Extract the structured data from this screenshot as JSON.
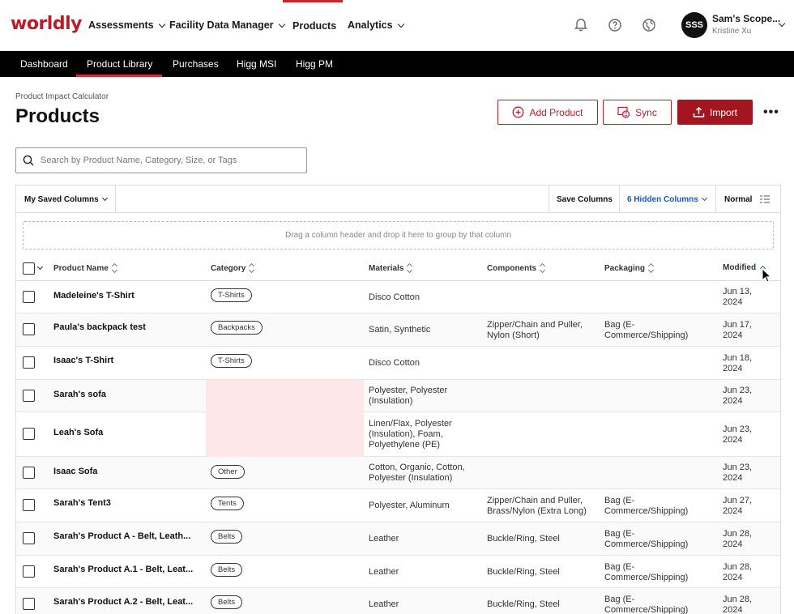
{
  "nav": {
    "logo": "worldly",
    "items": [
      {
        "label": "Assessments",
        "has_dropdown": true
      },
      {
        "label": "Facility Data Manager",
        "has_dropdown": true
      },
      {
        "label": "Products",
        "has_dropdown": false,
        "active": true
      },
      {
        "label": "Analytics",
        "has_dropdown": true
      }
    ],
    "icons": [
      "bell-icon",
      "help-icon",
      "globe-icon"
    ],
    "user": {
      "initials": "SSS",
      "name": "Sam's Scope...",
      "sub": "Kristine Xu"
    }
  },
  "subnav": {
    "items": [
      "Dashboard",
      "Product Library",
      "Purchases",
      "Higg MSI",
      "Higg PM"
    ],
    "active": "Product Library"
  },
  "page": {
    "breadcrumb": "Product Impact Calculator",
    "title": "Products",
    "buttons": {
      "add": "Add Product",
      "sync": "Sync",
      "import": "Import"
    }
  },
  "search": {
    "placeholder": "Search by Product Name, Category, Size, or Tags"
  },
  "toolbar": {
    "saved_columns": "My Saved Columns",
    "save_columns": "Save Columns",
    "hidden_columns": "6 Hidden Columns",
    "density": "Normal"
  },
  "dropzone": "Drag a column header and drop it here to group by that column",
  "columns": {
    "name": "Product Name",
    "category": "Category",
    "materials": "Materials",
    "components": "Components",
    "packaging": "Packaging",
    "modified": "Modified"
  },
  "rows": [
    {
      "name": "Madeleine's T-Shirt",
      "category": "T-Shirts",
      "materials": "Disco Cotton",
      "components": "",
      "packaging": "",
      "modified": "Jun 13, 2024"
    },
    {
      "name": "Paula's backpack test",
      "category": "Backpacks",
      "materials": "Satin, Synthetic",
      "components": "Zipper/Chain and Puller, Nylon (Short)",
      "packaging": "Bag (E-Commerce/Shipping)",
      "modified": "Jun 17, 2024"
    },
    {
      "name": "Isaac's T-Shirt",
      "category": "T-Shirts",
      "materials": "Disco Cotton",
      "components": "",
      "packaging": "",
      "modified": "Jun 18, 2024"
    },
    {
      "name": "Sarah's sofa",
      "category": "",
      "materials": "Polyester, Polyester (Insulation)",
      "components": "",
      "packaging": "",
      "modified": "Jun 23, 2024"
    },
    {
      "name": "Leah's Sofa",
      "category": "",
      "materials": "Linen/Flax, Polyester (Insulation), Foam, Polyethylene (PE)",
      "components": "",
      "packaging": "",
      "modified": "Jun 23, 2024"
    },
    {
      "name": "Isaac Sofa",
      "category": "Other",
      "materials": "Cotton, Organic, Cotton, Polyester (Insulation)",
      "components": "",
      "packaging": "",
      "modified": "Jun 23, 2024"
    },
    {
      "name": "Sarah's Tent3",
      "category": "Tents",
      "materials": "Polyester, Aluminum",
      "components": "Zipper/Chain and Puller, Brass/Nylon (Extra Long)",
      "packaging": "Bag (E-Commerce/Shipping)",
      "modified": "Jun 27, 2024"
    },
    {
      "name": "Sarah's Product A - Belt, Leath...",
      "category": "Belts",
      "materials": "Leather",
      "components": "Buckle/Ring, Steel",
      "packaging": "Bag (E-Commerce/Shipping)",
      "modified": "Jun 28, 2024"
    },
    {
      "name": "Sarah's Product A.1 - Belt, Leat...",
      "category": "Belts",
      "materials": "Leather",
      "components": "Buckle/Ring, Steel",
      "packaging": "Bag (E-Commerce/Shipping)",
      "modified": "Jun 28, 2024"
    },
    {
      "name": "Sarah's Product A.2 - Belt, Leat...",
      "category": "Belts",
      "materials": "Leather",
      "components": "Buckle/Ring, Steel",
      "packaging": "Bag (E-Commerce/Shipping)",
      "modified": "Jun 28, 2024"
    }
  ],
  "colors": {
    "brand": "#b81d2b",
    "missing_cell": "#fde7e8",
    "link_blue": "#1a56c4"
  }
}
